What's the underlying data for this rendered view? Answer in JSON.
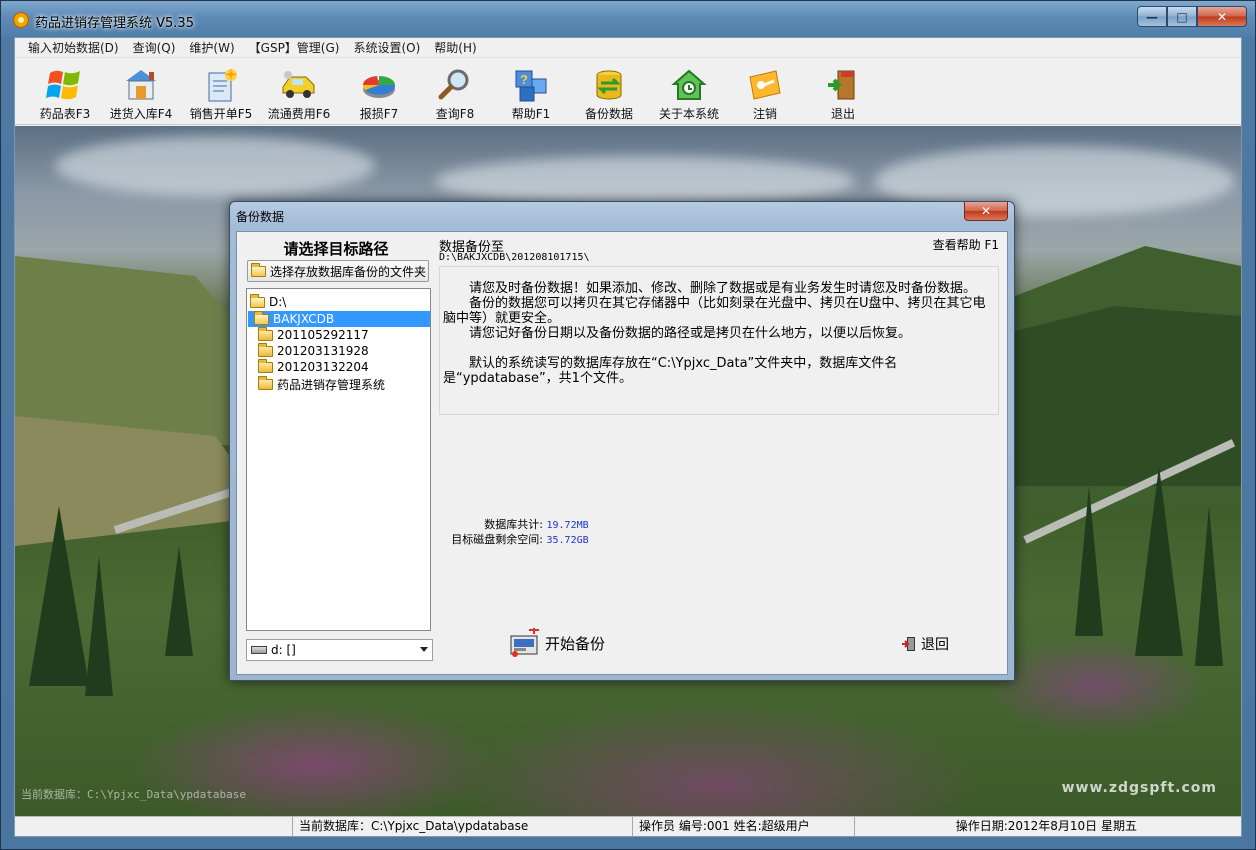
{
  "window": {
    "title": "药品进销存管理系统 V5.35",
    "minimize_glyph": "—",
    "maximize_glyph": "□",
    "close_glyph": "✕"
  },
  "menu": [
    {
      "label": "输入初始数据(D)"
    },
    {
      "label": "查询(Q)"
    },
    {
      "label": "维护(W)"
    },
    {
      "label": "【GSP】管理(G)"
    },
    {
      "label": "系统设置(O)"
    },
    {
      "label": "帮助(H)"
    }
  ],
  "toolbar": [
    {
      "label": "药品表F3",
      "icon": "windows-logo-icon"
    },
    {
      "label": "进货入库F4",
      "icon": "warehouse-icon"
    },
    {
      "label": "销售开单F5",
      "icon": "sales-invoice-icon"
    },
    {
      "label": "流通费用F6",
      "icon": "truck-icon"
    },
    {
      "label": "报损F7",
      "icon": "pie-chart-icon"
    },
    {
      "label": "查询F8",
      "icon": "magnifier-icon"
    },
    {
      "label": "帮助F1",
      "icon": "help-cubes-icon"
    },
    {
      "label": "备份数据",
      "icon": "database-backup-icon"
    },
    {
      "label": "关于本系统",
      "icon": "about-house-icon"
    },
    {
      "label": "注销",
      "icon": "logout-key-icon"
    },
    {
      "label": "退出",
      "icon": "exit-door-icon"
    }
  ],
  "desktop": {
    "watermark": "www.zdgspft.com",
    "db_path_overlay": "当前数据库：C:\\Ypjxc_Data\\ypdatabase"
  },
  "dialog": {
    "title": "备份数据",
    "close_glyph": "✕",
    "left": {
      "heading": "请选择目标路径",
      "choose_folder_button": "选择存放数据库备份的文件夹",
      "tree": [
        {
          "label": "D:\\",
          "selected": false
        },
        {
          "label": "BAKJXCDB",
          "selected": true
        },
        {
          "label": "201105292117",
          "selected": false
        },
        {
          "label": "201203131928",
          "selected": false
        },
        {
          "label": "201203132204",
          "selected": false
        },
        {
          "label": "药品进销存管理系统",
          "selected": false
        }
      ],
      "drive_value": "d: []"
    },
    "right": {
      "backup_to_label": "数据备份至",
      "help_label": "查看帮助 F1",
      "backup_path": "D:\\BAKJXCDB\\201208101715\\",
      "notes": [
        "　　请您及时备份数据！如果添加、修改、删除了数据或是有业务发生时请您及时备份数据。",
        "　　备份的数据您可以拷贝在其它存储器中（比如刻录在光盘中、拷贝在U盘中、拷贝在其它电脑中等）就更安全。",
        "　　请您记好备份日期以及备份数据的路径或是拷贝在什么地方，以便以后恢复。",
        "",
        "　　默认的系统读写的数据库存放在“C:\\Ypjxc_Data”文件夹中，数据库文件名是“ypdatabase”，共1个文件。"
      ],
      "db_total_label": "数据库共计:",
      "db_total_value": "19.72MB",
      "free_space_label": "目标磁盘剩余空间:",
      "free_space_value": "35.72GB",
      "start_button": "开始备份",
      "back_button": "退回"
    }
  },
  "statusbar": {
    "current_db": "当前数据库：C:\\Ypjxc_Data\\ypdatabase",
    "operator": "操作员 编号:001  姓名:超级用户",
    "date": "操作日期:2012年8月10日 星期五"
  },
  "colors": {
    "selection": "#3399ff",
    "stat_value": "#1d35c9",
    "title_bar": "#5e8bb5",
    "close_red": "#c0391b"
  }
}
